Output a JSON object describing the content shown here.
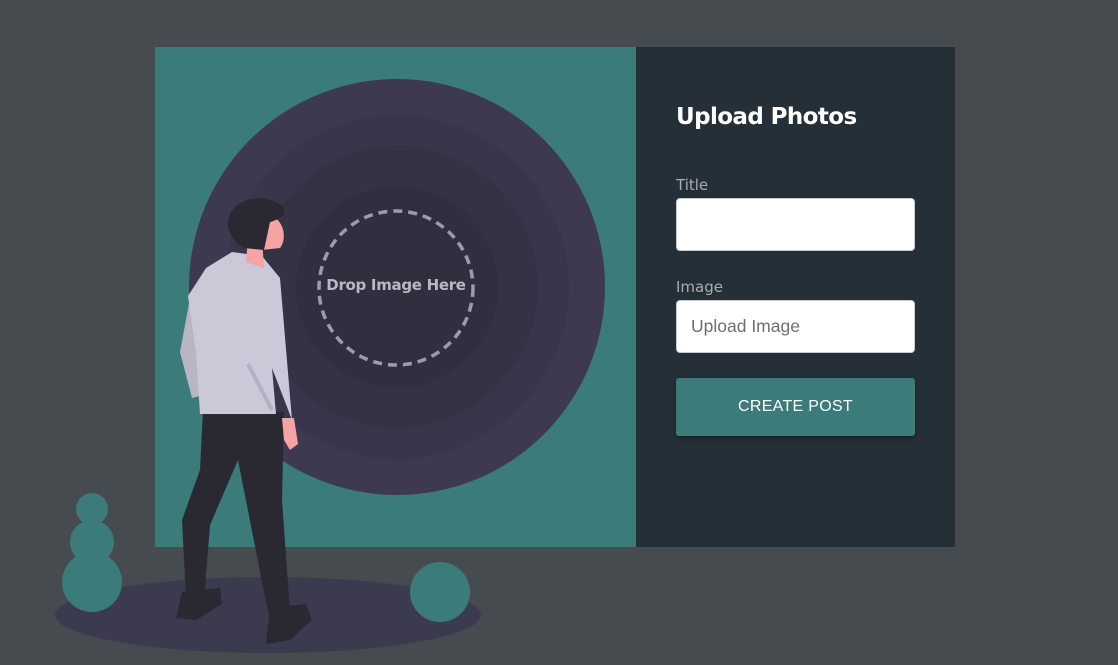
{
  "upload_form": {
    "heading": "Upload Photos",
    "title_label": "Title",
    "title_value": "",
    "image_label": "Image",
    "image_placeholder": "Upload Image",
    "submit_label": "CREATE POST"
  },
  "drop_zone": {
    "label": "Drop Image Here"
  },
  "colors": {
    "background": "#454b4e",
    "teal_panel": "#3b7b79",
    "form_panel": "#252f38",
    "accent_button": "#3b7b79",
    "disc": "#3b3a4f"
  }
}
